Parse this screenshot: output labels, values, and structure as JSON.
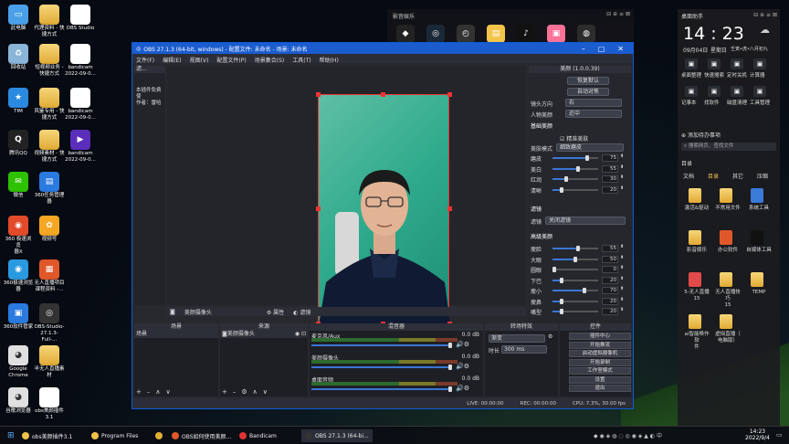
{
  "desktop": {
    "icons": [
      {
        "label": "此电脑",
        "color": "#4aa0e8",
        "glyph": "▭"
      },
      {
        "label": "代理资料 - 快\n捷方式",
        "color": "#f0c24b",
        "glyph": ""
      },
      {
        "label": "OBS Studio",
        "color": "#ffffff",
        "glyph": ""
      },
      {
        "label": "回收站",
        "color": "#8ab4d8",
        "glyph": "♻"
      },
      {
        "label": "短视频业务 - \n快捷方式",
        "color": "#f0c24b",
        "glyph": ""
      },
      {
        "label": "bandicam\n2022-09-0...",
        "color": "#ffffff",
        "glyph": ""
      },
      {
        "label": "TIM",
        "color": "#2a8ae0",
        "glyph": "★"
      },
      {
        "label": "风鉴专用 - 快\n捷方式",
        "color": "#f0c24b",
        "glyph": ""
      },
      {
        "label": "bandicam\n2022-09-0...",
        "color": "#ffffff",
        "glyph": ""
      },
      {
        "label": "腾讯QQ",
        "color": "#222",
        "glyph": "Q"
      },
      {
        "label": "视频素材 - 快\n捷方式",
        "color": "#f0c24b",
        "glyph": ""
      },
      {
        "label": "bandicam\n2022-09-0...",
        "color": "#5a2dbb",
        "glyph": "▶"
      },
      {
        "label": "微信",
        "color": "#2dc100",
        "glyph": "✉"
      },
      {
        "label": "360任务管理\n器",
        "color": "#2a7ae0",
        "glyph": "▤"
      },
      {
        "label": "",
        "color": "",
        "glyph": ""
      },
      {
        "label": "360 极速浏览\n器X",
        "color": "#e24a2a",
        "glyph": "◉"
      },
      {
        "label": "视频号",
        "color": "#f5a623",
        "glyph": "✿"
      },
      {
        "label": "",
        "color": "",
        "glyph": ""
      },
      {
        "label": "360极速浏览\n器",
        "color": "#2a9ae0",
        "glyph": "◉"
      },
      {
        "label": "无人直播项目\n课程资料 -...",
        "color": "#e0582a",
        "glyph": "▦"
      },
      {
        "label": "",
        "color": "",
        "glyph": ""
      },
      {
        "label": "360软件管家",
        "color": "#2a7ae0",
        "glyph": "▣"
      },
      {
        "label": "OBS-Studio-\n27.1.3-Full-...",
        "color": "#333",
        "glyph": "◎"
      },
      {
        "label": "",
        "color": "",
        "glyph": ""
      },
      {
        "label": "Google\nChrome",
        "color": "#e0e0e0",
        "glyph": "◕"
      },
      {
        "label": "半无人直播素\n材",
        "color": "#f0c24b",
        "glyph": ""
      },
      {
        "label": "",
        "color": "",
        "glyph": ""
      },
      {
        "label": "谷歌浏览器",
        "color": "#e0e0e0",
        "glyph": "◕"
      },
      {
        "label": "obs美颜插件\n3.1",
        "color": "#ffffff",
        "glyph": ""
      }
    ]
  },
  "topdock": {
    "title": "影音娱乐",
    "apps": [
      {
        "name": "alien-icon",
        "color": "#222",
        "glyph": "◆"
      },
      {
        "name": "steam-icon",
        "color": "#1b2838",
        "glyph": "◎"
      },
      {
        "name": "clock-app-icon",
        "color": "#333",
        "glyph": "◴"
      },
      {
        "name": "folder-app-icon",
        "color": "#f5c54b",
        "glyph": "▤"
      },
      {
        "name": "tiktok-icon",
        "color": "#111",
        "glyph": "♪"
      },
      {
        "name": "bilibili-icon",
        "color": "#fb7299",
        "glyph": "▣"
      },
      {
        "name": "extra-app-icon",
        "color": "#2c2c2c",
        "glyph": "◍"
      }
    ]
  },
  "rightpanel": {
    "title": "桌面助手",
    "time": "14 : 23",
    "date": "09月04日",
    "weekday": "星期日",
    "lunar": "壬寅•虎•八月初九",
    "shortcuts": [
      "桌面整理",
      "快速搜索",
      "定时关机",
      "计算器",
      "记事本",
      "找软件",
      "磁盘清理",
      "工具管理"
    ],
    "todo": "添加待办事项",
    "search_placeholder": "搜索网页、查找文件",
    "tabs": [
      "文档",
      "目录",
      "其它",
      "压缩"
    ],
    "folders": [
      {
        "label": "激活&驱动",
        "color": "#f0c24b"
      },
      {
        "label": "不常用文件",
        "color": "#f0c24b"
      },
      {
        "label": "系统工具",
        "color": "#3a7ad8"
      },
      {
        "label": "影音娱乐",
        "color": "#f0c24b"
      },
      {
        "label": "办公软件",
        "color": "#e0582a"
      },
      {
        "label": "自媒体工具",
        "color": "#111"
      },
      {
        "label": "5-无人直播\n15",
        "color": "#e04a4a"
      },
      {
        "label": "无人直播技巧\n15",
        "color": "#f0c24b"
      },
      {
        "label": "TEMP",
        "color": "#f0c24b"
      },
      {
        "label": "ai智能唤作软\n件",
        "color": "#f0c24b"
      },
      {
        "label": "虚拟直播（\n电脑版）",
        "color": "#f0c24b"
      }
    ]
  },
  "obs": {
    "title": "OBS 27.1.3 (64-bit, windows) - 配置文件: 未命名 - 场景: 未命名",
    "menu": [
      "文件(F)",
      "编辑(E)",
      "视图(V)",
      "配置文件(P)",
      "场景集合(S)",
      "工具(T)",
      "帮助(H)"
    ],
    "left_hdr": "滤...",
    "left_text": "本插件免费使\n作者：雷哈",
    "source_label": "美颜摄像头",
    "props": "属性",
    "filters": "滤镜",
    "beauty": {
      "title": "美颜 (1.0.0.39)",
      "btn_restore": "恢复默认",
      "btn_auto": "自动对焦",
      "camera_dir_label": "镜头方向",
      "camera_dir": "右",
      "face_count_label": "人物美颜",
      "face_count": "近中",
      "basic": "基础美颜",
      "fine": "精准美肤",
      "mode_label": "美肤模式",
      "mode": "细致磨皮",
      "rows": [
        {
          "label": "磨皮",
          "value": 75
        },
        {
          "label": "美白",
          "value": 55
        },
        {
          "label": "红润",
          "value": 30
        },
        {
          "label": "清晰",
          "value": 20
        }
      ],
      "filter_title": "滤镜",
      "filter_label": "滤镜",
      "filter_value": "关闭滤镜",
      "adv": "高级美颜",
      "adv_rows": [
        {
          "label": "瘦脸",
          "value": 55
        },
        {
          "label": "大眼",
          "value": 50
        },
        {
          "label": "圆眼",
          "value": 0
        },
        {
          "label": "下巴",
          "value": 20
        },
        {
          "label": "瘦小",
          "value": 70
        },
        {
          "label": "瘦鼻",
          "value": 20
        },
        {
          "label": "嘴型",
          "value": 20
        }
      ]
    },
    "scenes": {
      "title": "场景",
      "items": [
        "场景"
      ]
    },
    "sources": {
      "title": "来源",
      "items": [
        "美颜摄像头"
      ]
    },
    "mixer": {
      "title": "混音器",
      "channels": [
        {
          "name": "麦克风/Aux",
          "db": "0.0 dB"
        },
        {
          "name": "美颜摄像头",
          "db": "0.0 dB"
        },
        {
          "name": "桌面音频",
          "db": "0.0 dB"
        }
      ]
    },
    "transitions": {
      "title": "转场特效",
      "type": "渐变",
      "duration_label": "时长",
      "duration": "300 ms"
    },
    "controls": {
      "title": "控件",
      "items": [
        "插件中心",
        "开始推流",
        "启动虚拟摄像机",
        "开始录制",
        "工作室模式",
        "设置",
        "退出"
      ]
    },
    "status": {
      "live": "LIVE: 00:00:00",
      "rec": "REC: 00:00:00",
      "cpu": "CPU: 7.3%, 30.00 fps"
    }
  },
  "taskbar": {
    "items": [
      {
        "label": "obs美颜插件3.1",
        "color": "#f0c24b"
      },
      {
        "label": "Program Files",
        "color": "#f0c24b"
      },
      {
        "label": "",
        "color": "#e0b030"
      },
      {
        "label": "OBS如何使用美颜...",
        "color": "#e0582a"
      },
      {
        "label": "Bandicam",
        "color": "#d33"
      },
      {
        "label": "OBS 27.1.3 (64-bi...",
        "color": "#333"
      }
    ],
    "time": "14:23",
    "date": "2022/9/4"
  }
}
